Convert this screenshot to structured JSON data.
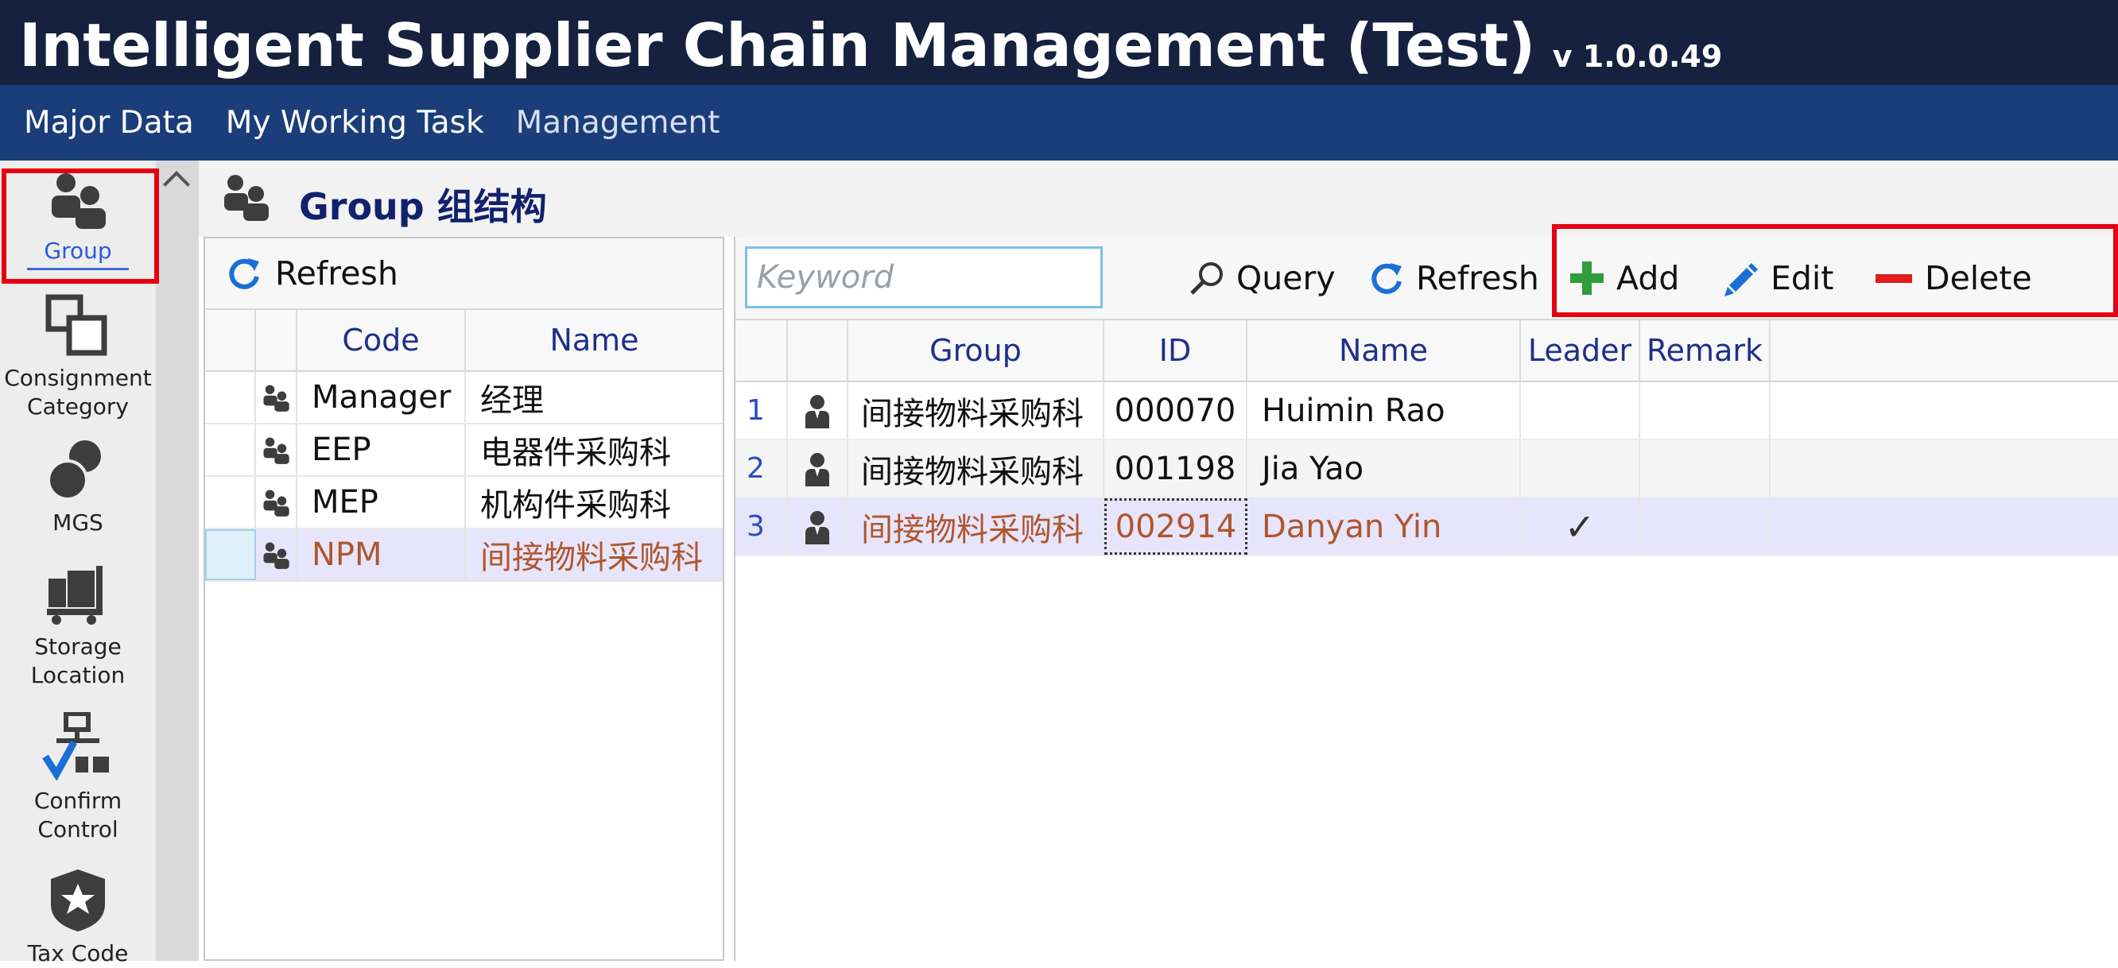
{
  "app": {
    "title": "Intelligent Supplier Chain Management (Test)",
    "version": "v 1.0.0.49"
  },
  "menu": [
    "Major Data",
    "My Working Task",
    "Management"
  ],
  "nav": [
    {
      "icon": "group-icon",
      "label": "Group",
      "active": true
    },
    {
      "icon": "consignment-category-icon",
      "label": "Consignment Category"
    },
    {
      "icon": "mgs-icon",
      "label": "MGS"
    },
    {
      "icon": "storage-location-icon",
      "label": "Storage Location"
    },
    {
      "icon": "confirm-control-icon",
      "label": "Confirm Control"
    },
    {
      "icon": "tax-code-icon",
      "label": "Tax Code"
    }
  ],
  "page": {
    "title": "Group 组结构"
  },
  "left_panel": {
    "refresh_label": "Refresh",
    "columns": [
      "Code",
      "Name"
    ],
    "rows": [
      {
        "code": "Manager",
        "name": "经理"
      },
      {
        "code": "EEP",
        "name": "电器件采购科"
      },
      {
        "code": "MEP",
        "name": "机构件采购科"
      },
      {
        "code": "NPM",
        "name": "间接物料采购科",
        "selected": true
      }
    ]
  },
  "right_panel": {
    "search_placeholder": "Keyword",
    "query_label": "Query",
    "refresh_label": "Refresh",
    "add_label": "Add",
    "edit_label": "Edit",
    "delete_label": "Delete",
    "columns": [
      "Group",
      "ID",
      "Name",
      "Leader",
      "Remark"
    ],
    "rows": [
      {
        "n": "1",
        "group": "间接物料采购科",
        "id": "000070",
        "name": "Huimin Rao",
        "leader": "",
        "remark": ""
      },
      {
        "n": "2",
        "group": "间接物料采购科",
        "id": "001198",
        "name": "Jia Yao",
        "leader": "",
        "remark": ""
      },
      {
        "n": "3",
        "group": "间接物料采购科",
        "id": "002914",
        "name": "Danyan Yin",
        "leader": "✓",
        "remark": "",
        "selected": true
      }
    ]
  },
  "colors": {
    "title_bg": "#15213f",
    "menu_bg": "#1b3d7a",
    "highlight_box": "#e60012",
    "selected_row_bg": "#e7e5fb",
    "selected_text": "#b0562e"
  }
}
